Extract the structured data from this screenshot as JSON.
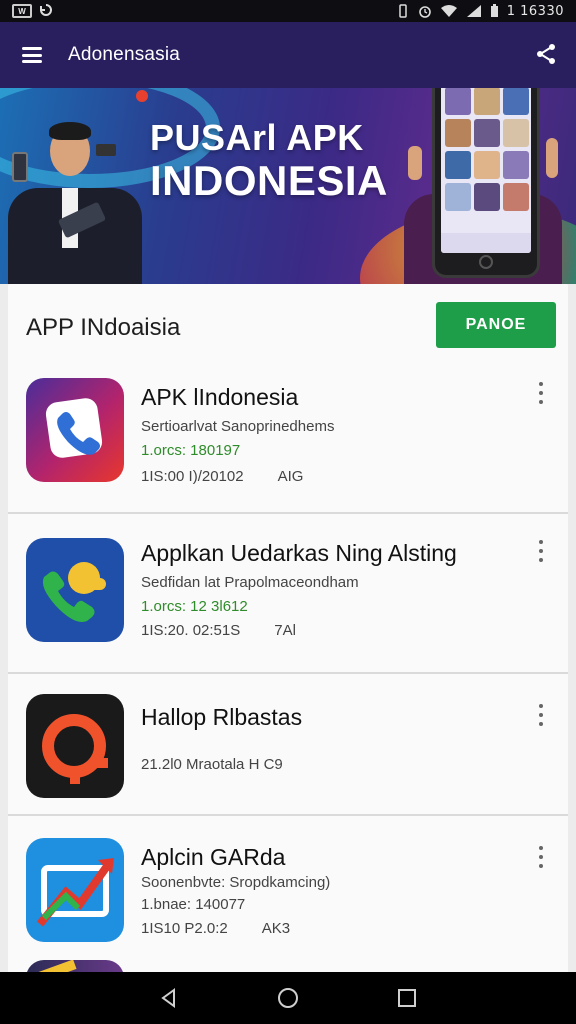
{
  "status_bar": {
    "time": "1 16330"
  },
  "app_bar": {
    "title": "Adonensasia"
  },
  "banner": {
    "title_line1": "PUSArl APK",
    "title_line2": "INDONESIA"
  },
  "section": {
    "title": "APP INdoaisia",
    "button_label": "PANOE"
  },
  "apps": [
    {
      "name": "APK lIndonesia",
      "subtitle": "Sertioarlvat Sanoprinedhems",
      "downloads": "1.orcs: 180197",
      "date": "1IS:00 I)/20102",
      "size": "AIG"
    },
    {
      "name": "Applkan Uedarkas Ning Alsting",
      "subtitle": "Sedfidan lat Prapolmaceondham",
      "downloads": "1.orcs: 12 3l612",
      "date": "1IS:20. 02:51S",
      "size": "7Al"
    },
    {
      "name": "Hallop Rlbastas",
      "info": "21.2l0 Mraotala H C9"
    },
    {
      "name": "Aplcin GARda",
      "subtitle": "Soonenbvte: Sropdkamcing)",
      "downloads": "1.bnae: 140077",
      "date": "1IS10 P2.0:2",
      "size": "AK3"
    }
  ],
  "colors": {
    "app_bar": "#2a1f5e",
    "accent_green": "#1f9e49",
    "download_text": "#2f8c2a"
  },
  "icons": [
    "wifi-icon",
    "signal-icon",
    "battery-icon",
    "alarm-icon",
    "menu-icon",
    "share-icon",
    "more-vert-icon",
    "back-icon",
    "home-icon",
    "recents-icon"
  ]
}
